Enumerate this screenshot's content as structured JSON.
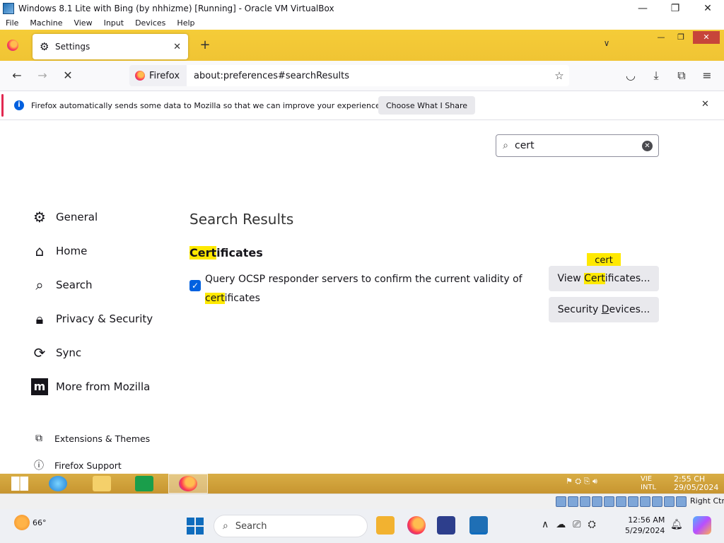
{
  "vbox": {
    "title": "Windows 8.1 Lite with Bing (by nhhizme) [Running] - Oracle VM VirtualBox",
    "menu": [
      "File",
      "Machine",
      "View",
      "Input",
      "Devices",
      "Help"
    ],
    "controls": {
      "minimize": "—",
      "maximize": "❐",
      "close": "✕"
    },
    "host_key": "Right Ctrl"
  },
  "firefox": {
    "tab": {
      "label": "Settings",
      "icon": "gear-icon"
    },
    "urlbar": {
      "identity": "Firefox",
      "url": "about:preferences#searchResults"
    },
    "notification": {
      "text": "Firefox automatically sends some data to Mozilla so that we can improve your experience.",
      "button": "Choose What I Share"
    }
  },
  "settings": {
    "search_value": "cert",
    "sidebar": [
      {
        "label": "General",
        "icon": "gear-icon"
      },
      {
        "label": "Home",
        "icon": "home-icon"
      },
      {
        "label": "Search",
        "icon": "search-icon"
      },
      {
        "label": "Privacy & Security",
        "icon": "lock-icon"
      },
      {
        "label": "Sync",
        "icon": "sync-icon"
      },
      {
        "label": "More from Mozilla",
        "icon": "mozilla-icon"
      }
    ],
    "sidebar_footer": [
      {
        "label": "Extensions & Themes",
        "icon": "puzzle-icon"
      },
      {
        "label": "Firefox Support",
        "icon": "help-icon"
      }
    ],
    "results_title": "Search Results",
    "section": {
      "heading_hl": "Cert",
      "heading_rest": "ificates"
    },
    "ocsp": {
      "checked": true,
      "text_before": "Query OCSP responder servers to confirm the current validity of ",
      "text_hl": "cert",
      "text_after": "ificates"
    },
    "tooltip": "cert",
    "view_certs": {
      "pre": "View ",
      "hl": "Cert",
      "post": "ificates..."
    },
    "security_devices": {
      "pre": "Security ",
      "ul": "D",
      "post": "evices..."
    }
  },
  "guest_taskbar": {
    "lang": [
      "VIE",
      "INTL"
    ],
    "time": [
      "2:55 CH",
      "29/05/2024"
    ]
  },
  "host_taskbar": {
    "weather": "66°",
    "search_placeholder": "Search",
    "time": "12:56 AM",
    "date": "5/29/2024"
  },
  "colors": {
    "firefox_theme": "#f2c636",
    "highlight": "#ffe900",
    "accent_blue": "#0061e0"
  }
}
